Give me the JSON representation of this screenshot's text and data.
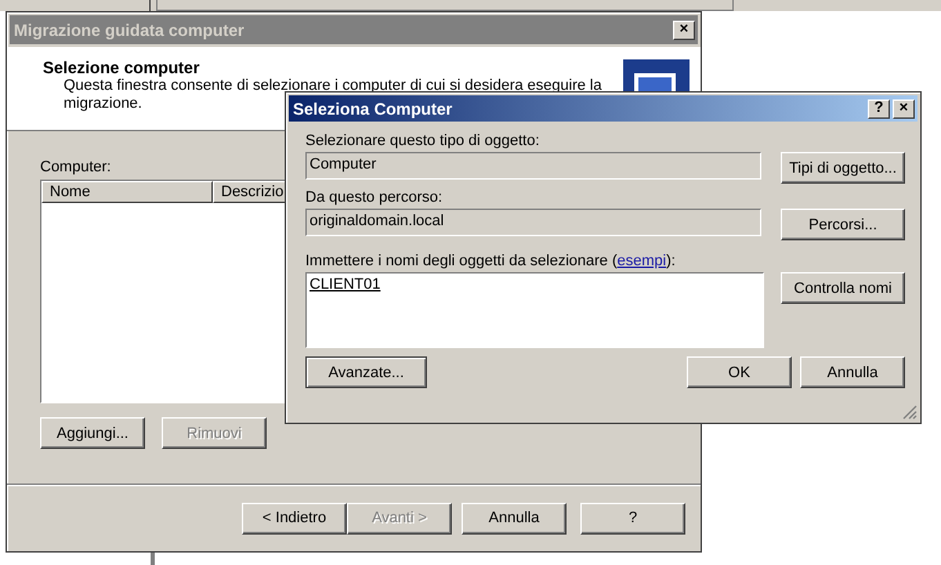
{
  "wizard": {
    "title": "Migrazione guidata computer",
    "heading": "Selezione computer",
    "description_lines": [
      "Questa finestra consente di selezionare i computer di cui si desidera eseguire la",
      "migrazione."
    ],
    "list_label": "Computer:",
    "columns": [
      "Nome",
      "Descrizio"
    ],
    "list_buttons": [
      {
        "label": "Aggiungi...",
        "disabled": false
      },
      {
        "label": "Rimuovi",
        "disabled": true
      }
    ],
    "nav_buttons": [
      {
        "label": "< Indietro",
        "disabled": false
      },
      {
        "label": "Avanti >",
        "disabled": true
      },
      {
        "label": "Annulla",
        "disabled": false
      },
      {
        "label": "?",
        "disabled": false
      }
    ]
  },
  "dialog": {
    "title": "Seleziona Computer",
    "help": "?",
    "close": "×",
    "type_label": "Selezionare questo tipo di oggetto:",
    "type_value": "Computer",
    "type_button": "Tipi di oggetto...",
    "location_label": "Da questo percorso:",
    "location_value": "originaldomain.local",
    "location_button": "Percorsi...",
    "names_label": "Immettere i nomi degli oggetti da selezionare (",
    "names_link": "esempi",
    "names_label_end": "):",
    "names_value": "CLIENT01",
    "check_button": "Controlla nomi",
    "advanced_button": "Avanzate...",
    "ok_button": "OK",
    "cancel_button": "Annulla"
  }
}
